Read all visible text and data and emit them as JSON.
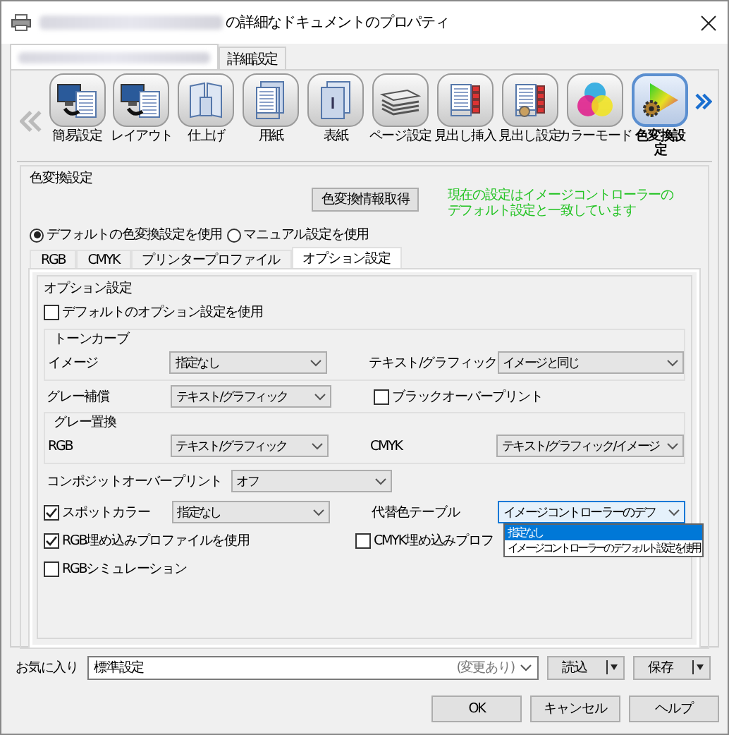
{
  "window": {
    "title": "の詳細なドキュメントのプロパティ"
  },
  "tabs": [
    {
      "kind": "blurred",
      "selected": true
    },
    {
      "kind": "text",
      "label": "詳細設定",
      "selected": false
    }
  ],
  "toolbar": {
    "items": [
      {
        "kind": "quick",
        "label": "簡易設定",
        "selected": false
      },
      {
        "kind": "layout",
        "label": "レイアウト",
        "selected": false
      },
      {
        "kind": "finishing",
        "label": "仕上げ",
        "selected": false
      },
      {
        "kind": "paper",
        "label": "用紙",
        "selected": false
      },
      {
        "kind": "cover",
        "label": "表紙",
        "selected": false
      },
      {
        "kind": "page",
        "label": "ページ設定",
        "selected": false
      },
      {
        "kind": "tab_insert",
        "label": "見出し挿入",
        "selected": false
      },
      {
        "kind": "tab_setting",
        "label": "見出し設定",
        "selected": false
      },
      {
        "kind": "color_mode",
        "label": "カラーモード",
        "selected": false
      },
      {
        "kind": "color_convert",
        "label": "色変換設定",
        "selected": true
      }
    ]
  },
  "color_conversion": {
    "title": "色変換設定",
    "fetch_button": "色変換情報取得",
    "status_note": "現在の設定はイメージコントローラーのデフォルト設定と一致しています",
    "radios": [
      {
        "label": "デフォルトの色変換設定を使用",
        "selected": true
      },
      {
        "label": "マニュアル設定を使用",
        "selected": false
      }
    ],
    "subtabs": [
      {
        "label": "RGB",
        "selected": false
      },
      {
        "label": "CMYK",
        "selected": false
      },
      {
        "label": "プリンタープロファイル",
        "selected": false
      },
      {
        "label": "オプション設定",
        "selected": true
      }
    ],
    "options": {
      "title": "オプション設定",
      "use_default": {
        "label": "デフォルトのオプション設定を使用",
        "checked": false
      },
      "tone_curve": {
        "title": "トーンカーブ",
        "image": {
          "label": "イメージ",
          "value": "指定なし"
        },
        "text_graphics": {
          "label": "テキスト/グラフィック",
          "value": "イメージと同じ"
        }
      },
      "gray_compensation": {
        "label": "グレー補償",
        "value": "テキスト/グラフィック"
      },
      "black_overprint": {
        "label": "ブラックオーバープリント",
        "checked": false
      },
      "gray_replacement": {
        "title": "グレー置換",
        "rgb": {
          "label": "RGB",
          "value": "テキスト/グラフィック"
        },
        "cmyk": {
          "label": "CMYK",
          "value": "テキスト/グラフィック/イメージ"
        }
      },
      "composite_overprint": {
        "label": "コンポジットオーバープリント",
        "value": "オフ"
      },
      "spot_color": {
        "label": "スポットカラー",
        "checked": true,
        "value": "指定なし"
      },
      "substitute_table": {
        "label": "代替色テーブル",
        "value": "イメージコントローラーのデフ",
        "expanded": true,
        "options": [
          {
            "label": "指定なし",
            "selected": true
          },
          {
            "label": "イメージコントローラーのデフォルト設定を使用",
            "selected": false
          }
        ]
      },
      "rgb_embedded_profile": {
        "label": "RGB埋め込みプロファイルを使用",
        "checked": true
      },
      "cmyk_embedded_profile": {
        "label": "CMYK埋め込みプロフ",
        "checked": false
      },
      "rgb_simulation": {
        "label": "RGBシミュレーション",
        "checked": false
      }
    }
  },
  "favorites": {
    "label": "お気に入り",
    "value": "標準設定",
    "note": "(変更あり)",
    "load_button": "読込",
    "save_button": "保存"
  },
  "buttons": [
    "OK",
    "キャンセル",
    "ヘルプ"
  ]
}
